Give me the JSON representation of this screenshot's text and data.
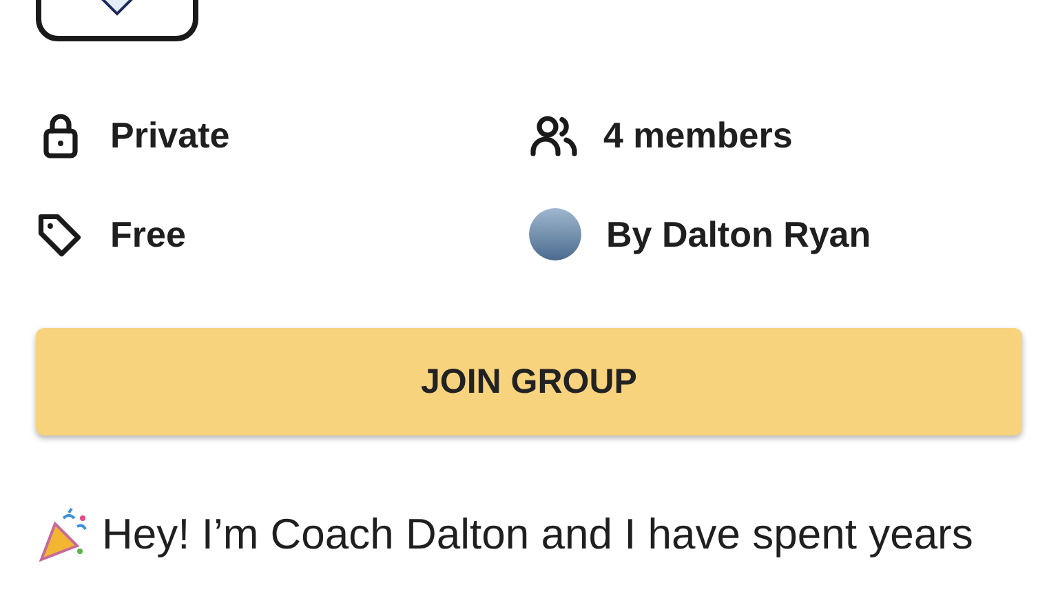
{
  "details": [
    {
      "kind": "lock",
      "text": "Private"
    },
    {
      "kind": "members",
      "text": "4 members"
    },
    {
      "kind": "tag",
      "text": "Free"
    },
    {
      "kind": "avatar",
      "text": "By Dalton Ryan"
    }
  ],
  "join_button": "JOIN GROUP",
  "description": "Hey! I’m Coach Dalton and I have spent years"
}
